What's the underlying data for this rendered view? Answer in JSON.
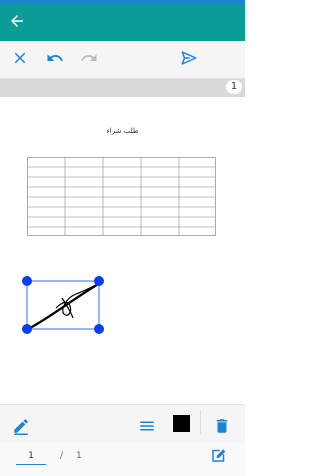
{
  "icons": {
    "back": "arrow-left-icon",
    "close": "close-icon",
    "undo": "undo-icon",
    "redo": "redo-icon",
    "send": "send-icon",
    "pen": "pen-icon",
    "lines": "line-weight-icon",
    "delete": "trash-icon",
    "edit_doc": "edit-document-icon"
  },
  "colors": {
    "appbar": "#0b9c97",
    "accent": "#1f84cf",
    "selection": "#0b3cf0",
    "ink": "#000000"
  },
  "page_indicator": "1",
  "document": {
    "title": "طلب شراء"
  },
  "toolbar": {
    "selected_color": "#000000"
  },
  "footer": {
    "current_page": "1",
    "separator": "/",
    "total_pages": "1"
  }
}
